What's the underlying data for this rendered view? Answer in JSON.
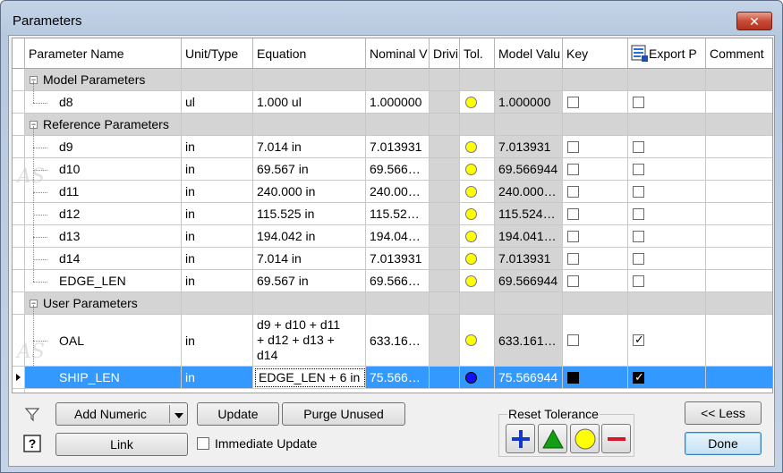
{
  "window": {
    "title": "Parameters",
    "close_glyph": "✕"
  },
  "columns": [
    "Parameter Name",
    "Unit/Type",
    "Equation",
    "Nominal V",
    "Drivi",
    "Tol.",
    "Model Valu",
    "Key",
    "Export P",
    "Comment"
  ],
  "groups": [
    {
      "label": "Model Parameters",
      "rows": [
        {
          "name": "d8",
          "unit": "ul",
          "equation": "1.000 ul",
          "nominal": "1.000000",
          "model": "1.000000",
          "key": false,
          "export": false
        }
      ]
    },
    {
      "label": "Reference Parameters",
      "rows": [
        {
          "name": "d9",
          "unit": "in",
          "equation": "7.014 in",
          "nominal": "7.013931",
          "model": "7.013931",
          "key": false,
          "export": false
        },
        {
          "name": "d10",
          "unit": "in",
          "equation": "69.567 in",
          "nominal": "69.566…",
          "model": "69.566944",
          "key": false,
          "export": false
        },
        {
          "name": "d11",
          "unit": "in",
          "equation": "240.000 in",
          "nominal": "240.00…",
          "model": "240.000…",
          "key": false,
          "export": false
        },
        {
          "name": "d12",
          "unit": "in",
          "equation": "115.525 in",
          "nominal": "115.52…",
          "model": "115.524…",
          "key": false,
          "export": false
        },
        {
          "name": "d13",
          "unit": "in",
          "equation": "194.042 in",
          "nominal": "194.04…",
          "model": "194.041…",
          "key": false,
          "export": false
        },
        {
          "name": "d14",
          "unit": "in",
          "equation": "7.014 in",
          "nominal": "7.013931",
          "model": "7.013931",
          "key": false,
          "export": false
        },
        {
          "name": "EDGE_LEN",
          "unit": "in",
          "equation": "69.567 in",
          "nominal": "69.566…",
          "model": "69.566944",
          "key": false,
          "export": false
        }
      ]
    },
    {
      "label": "User Parameters",
      "rows": [
        {
          "name": "OAL",
          "unit": "in",
          "equation_lines": [
            "d9 + d10 + d11",
            "+ d12 + d13 +",
            "d14"
          ],
          "nominal": "633.16…",
          "model": "633.161…",
          "key": false,
          "export": true
        },
        {
          "name": "SHIP_LEN",
          "unit": "in",
          "equation": "EDGE_LEN + 6 in",
          "nominal": "75.566…",
          "model": "75.566944",
          "key": true,
          "export": true,
          "selected": true
        }
      ]
    }
  ],
  "buttons": {
    "add_numeric": "Add Numeric",
    "update": "Update",
    "purge_unused": "Purge Unused",
    "link": "Link",
    "immediate_update": "Immediate Update",
    "less": "<< Less",
    "done": "Done"
  },
  "reset_tolerance": {
    "label": "Reset Tolerance"
  },
  "colors": {
    "selection": "#3399ff",
    "group_bg": "#d4d4d4",
    "tol_yellow": "#ffff00",
    "tol_blue": "#1010ff"
  }
}
